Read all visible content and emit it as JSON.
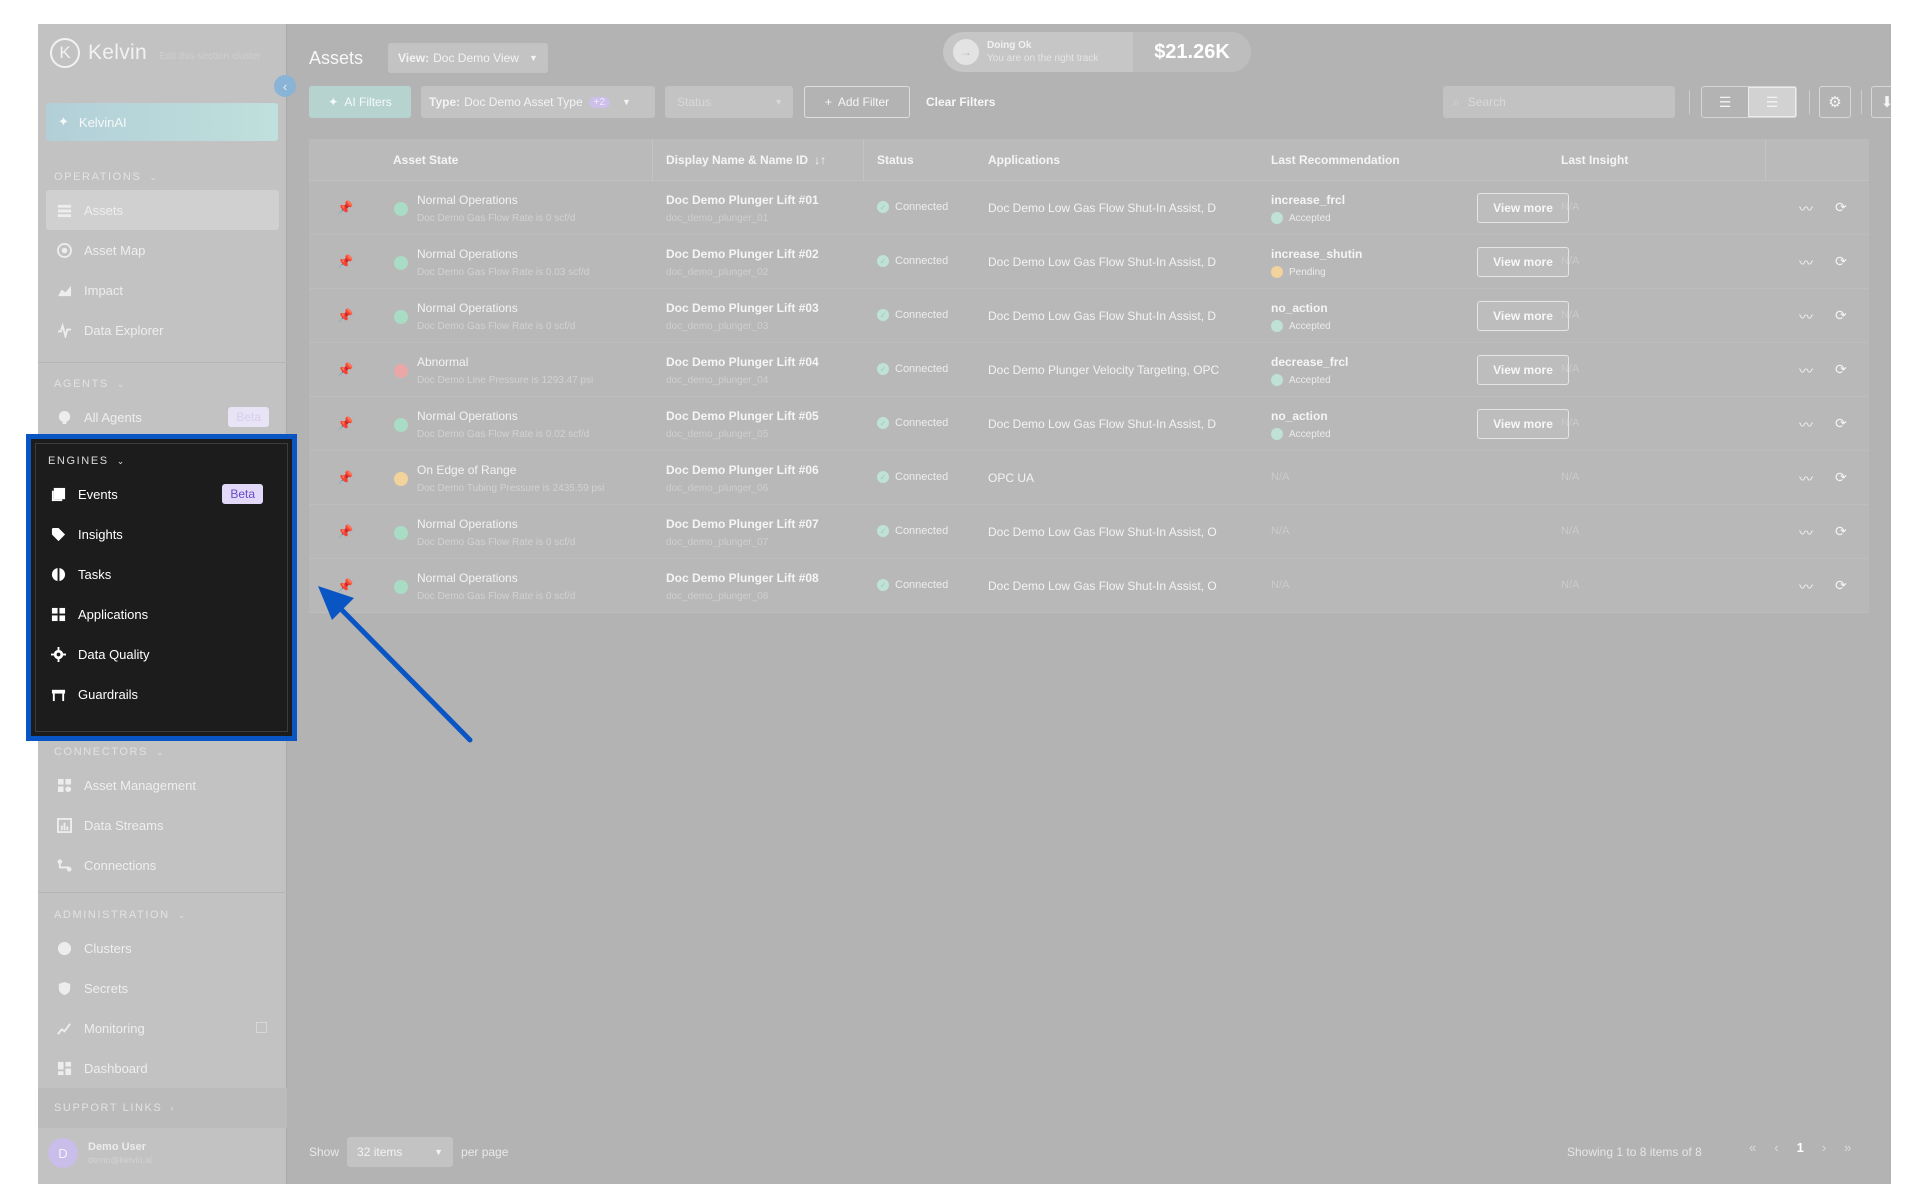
{
  "brand": {
    "name": "Kelvin",
    "logo_letter": "K",
    "subtitle": "Edit this section cluster"
  },
  "sidebar": {
    "ai_label": "KelvinAI",
    "sections": {
      "operations": {
        "title": "OPERATIONS",
        "items": [
          "Assets",
          "Asset Map",
          "Impact",
          "Data Explorer"
        ]
      },
      "agents": {
        "title": "AGENTS",
        "items": [
          "All Agents"
        ],
        "badge": "Beta"
      },
      "engines": {
        "title": "ENGINES",
        "items": [
          "Events",
          "Insights",
          "Tasks",
          "Applications",
          "Data Quality",
          "Guardrails"
        ],
        "badge": "Beta"
      },
      "connectors": {
        "title": "CONNECTORS",
        "items": [
          "Asset Management",
          "Data Streams",
          "Connections"
        ]
      },
      "administration": {
        "title": "ADMINISTRATION",
        "items": [
          "Clusters",
          "Secrets",
          "Monitoring",
          "Dashboard"
        ]
      },
      "support": {
        "title": "SUPPORT LINKS"
      }
    },
    "user": {
      "initial": "D",
      "name": "Demo User",
      "email": "demo@kelvin.ai"
    }
  },
  "header": {
    "title": "Assets",
    "view_prefix": "View:",
    "view_value": "Doc Demo View",
    "status_title": "Doing Ok",
    "status_sub": "You are on the right track",
    "amount": "$21.26K"
  },
  "toolbar": {
    "ai_filters": "AI Filters",
    "type_prefix": "Type:",
    "type_value": "Doc Demo Asset Type",
    "type_extra": "+2",
    "status_placeholder": "Status",
    "add_filter": "Add Filter",
    "clear_filters": "Clear Filters",
    "search_placeholder": "Search"
  },
  "table": {
    "headers": {
      "asset_state": "Asset State",
      "display_name": "Display Name & Name ID",
      "status": "Status",
      "applications": "Applications",
      "last_recommendation": "Last Recommendation",
      "last_insight": "Last Insight"
    },
    "view_more": "View more",
    "rows": [
      {
        "state": "Normal Operations",
        "state_detail": "Doc Demo Gas Flow Rate is 0 scf/d",
        "state_color": "#a9dcc4",
        "name": "Doc Demo Plunger Lift #01",
        "id": "doc_demo_plunger_01",
        "status": "Connected",
        "apps": "Doc Demo Low Gas Flow Shut-In Assist, D",
        "rec": "increase_frcl",
        "rec_status": "Accepted",
        "rec_color": "#bfe1d6",
        "insight": "N/A"
      },
      {
        "state": "Normal Operations",
        "state_detail": "Doc Demo Gas Flow Rate is 0.03 scf/d",
        "state_color": "#a9dcc4",
        "name": "Doc Demo Plunger Lift #02",
        "id": "doc_demo_plunger_02",
        "status": "Connected",
        "apps": "Doc Demo Low Gas Flow Shut-In Assist, D",
        "rec": "increase_shutin",
        "rec_status": "Pending",
        "rec_color": "#f1d39b",
        "insight": "N/A"
      },
      {
        "state": "Normal Operations",
        "state_detail": "Doc Demo Gas Flow Rate is 0 scf/d",
        "state_color": "#a9dcc4",
        "name": "Doc Demo Plunger Lift #03",
        "id": "doc_demo_plunger_03",
        "status": "Connected",
        "apps": "Doc Demo Low Gas Flow Shut-In Assist, D",
        "rec": "no_action",
        "rec_status": "Accepted",
        "rec_color": "#bfe1d6",
        "insight": "N/A"
      },
      {
        "state": "Abnormal",
        "state_detail": "Doc Demo Line Pressure is 1293.47 psi",
        "state_color": "#eba7a7",
        "name": "Doc Demo Plunger Lift #04",
        "id": "doc_demo_plunger_04",
        "status": "Connected",
        "apps": "Doc Demo Plunger Velocity Targeting, OPC",
        "rec": "decrease_frcl",
        "rec_status": "Accepted",
        "rec_color": "#bfe1d6",
        "insight": "N/A"
      },
      {
        "state": "Normal Operations",
        "state_detail": "Doc Demo Gas Flow Rate is 0.02 scf/d",
        "state_color": "#a9dcc4",
        "name": "Doc Demo Plunger Lift #05",
        "id": "doc_demo_plunger_05",
        "status": "Connected",
        "apps": "Doc Demo Low Gas Flow Shut-In Assist, D",
        "rec": "no_action",
        "rec_status": "Accepted",
        "rec_color": "#bfe1d6",
        "insight": "N/A"
      },
      {
        "state": "On Edge of Range",
        "state_detail": "Doc Demo Tubing Pressure is 2435.59 psi",
        "state_color": "#f1d39b",
        "name": "Doc Demo Plunger Lift #06",
        "id": "doc_demo_plunger_06",
        "status": "Connected",
        "apps": "OPC UA",
        "rec": "N/A",
        "rec_status": "",
        "rec_color": "",
        "insight": "N/A"
      },
      {
        "state": "Normal Operations",
        "state_detail": "Doc Demo Gas Flow Rate is 0 scf/d",
        "state_color": "#a9dcc4",
        "name": "Doc Demo Plunger Lift #07",
        "id": "doc_demo_plunger_07",
        "status": "Connected",
        "apps": "Doc Demo Low Gas Flow Shut-In Assist, O",
        "rec": "N/A",
        "rec_status": "",
        "rec_color": "",
        "insight": "N/A"
      },
      {
        "state": "Normal Operations",
        "state_detail": "Doc Demo Gas Flow Rate is 0 scf/d",
        "state_color": "#a9dcc4",
        "name": "Doc Demo Plunger Lift #08",
        "id": "doc_demo_plunger_08",
        "status": "Connected",
        "apps": "Doc Demo Low Gas Flow Shut-In Assist, O",
        "rec": "N/A",
        "rec_status": "",
        "rec_color": "",
        "insight": "N/A"
      }
    ]
  },
  "footer": {
    "show": "Show",
    "per_page_value": "32 items",
    "per_page": "per page",
    "info": "Showing 1 to 8 items of 8",
    "current_page": "1"
  },
  "colors": {
    "highlight": "#0a55c4",
    "arrow": "#0a55c4"
  }
}
